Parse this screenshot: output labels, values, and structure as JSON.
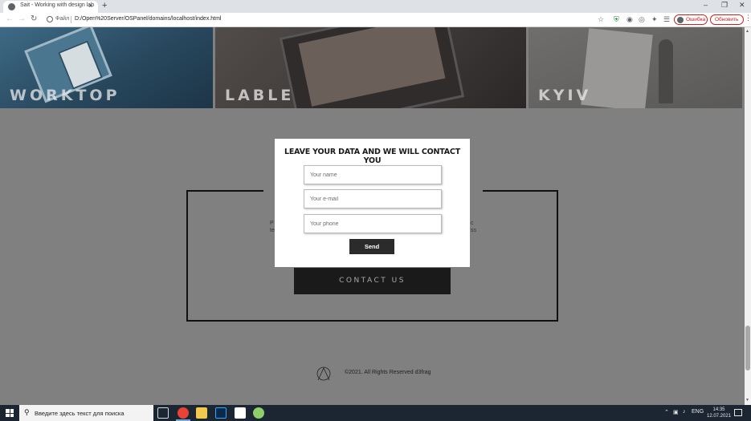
{
  "browser": {
    "tab_title": "Sait - Working with design lab",
    "tab_close": "×",
    "new_tab": "+",
    "win_controls": [
      "–",
      "❐",
      "✕"
    ],
    "file_label": "Файл",
    "url": "D:/Open%20Server/OSPanel/domains/localhost/index.html",
    "error_pill": "Ошибка",
    "update_pill": "Обновить"
  },
  "gallery": {
    "tiles": [
      {
        "label": "WORKTOP"
      },
      {
        "label": "LABLE"
      },
      {
        "label": "KYIV"
      }
    ]
  },
  "section": {
    "left_fragment": "P\nte",
    "right_fragment": "c\nss",
    "contact_button": "CONTACT US"
  },
  "modal": {
    "title": "LEAVE YOUR DATA AND WE WILL CONTACT YOU",
    "name_placeholder": "Your name",
    "email_placeholder": "Your e-mail",
    "phone_placeholder": "Your phone",
    "send_label": "Send"
  },
  "footer": {
    "copyright": "©2021. All Rights Reserved d3frag"
  },
  "taskbar": {
    "search_text": "Введите здесь текст для поиска",
    "lang": "ENG",
    "time": "14:35",
    "date": "12.07.2021"
  }
}
